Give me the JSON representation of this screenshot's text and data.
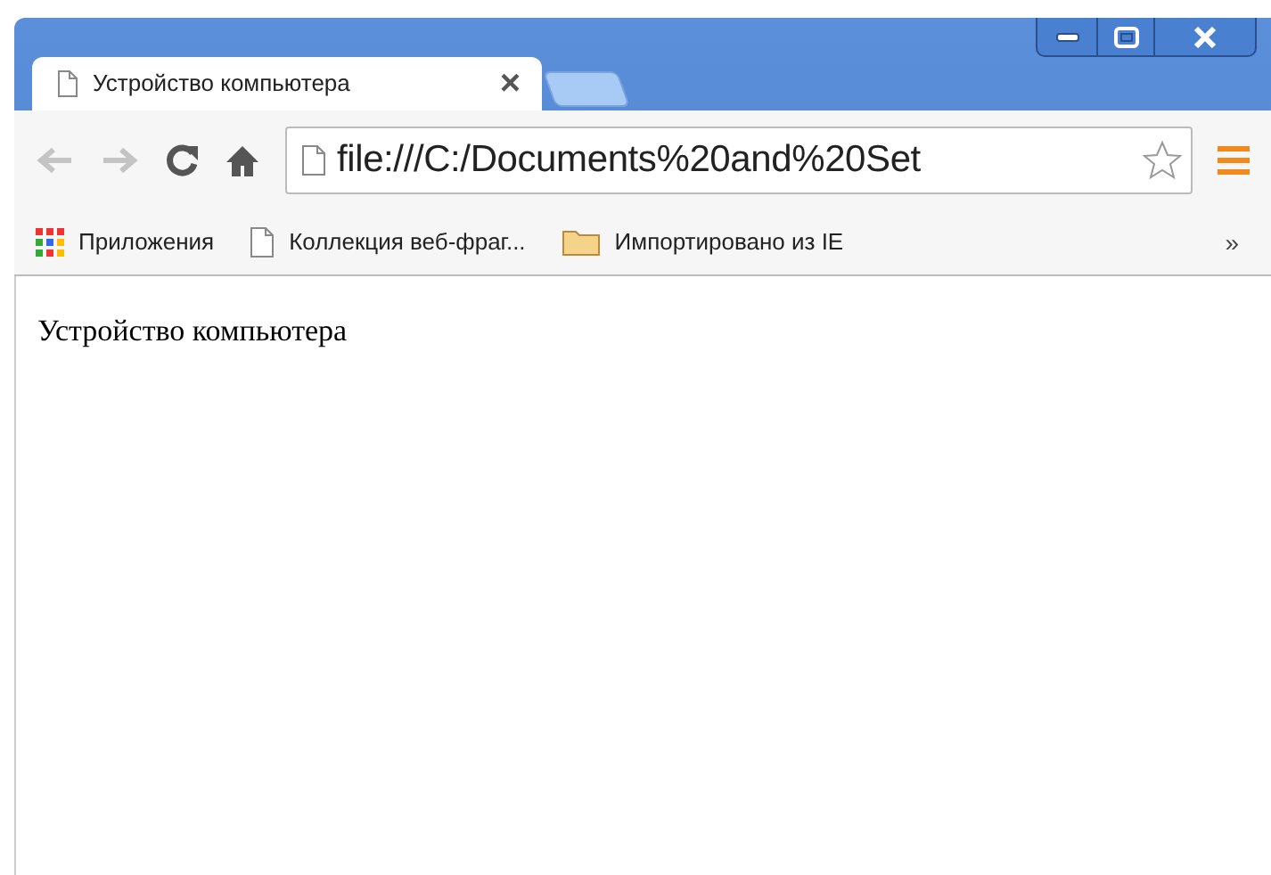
{
  "tabs": [
    {
      "title": "Устройство компьютера",
      "close": "×",
      "selected": true
    }
  ],
  "address_bar": {
    "url": "file:///C:/Documents%20and%20Set"
  },
  "bookmarks": [
    {
      "kind": "apps",
      "label": "Приложения"
    },
    {
      "kind": "page",
      "label": "Коллекция веб-фраг..."
    },
    {
      "kind": "folder",
      "label": "Импортировано из IE"
    }
  ],
  "bookmarks_overflow": "»",
  "page": {
    "text": "Устройство компьютера"
  }
}
